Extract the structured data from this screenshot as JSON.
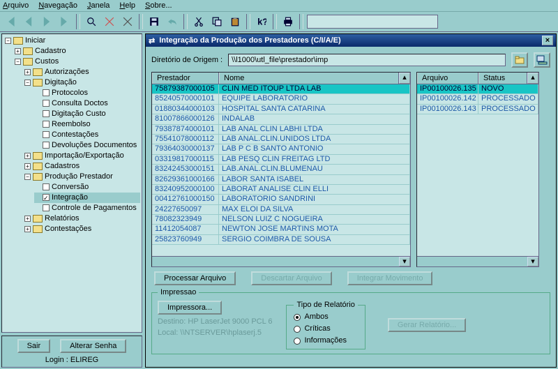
{
  "menu": {
    "arquivo": "Arquivo",
    "navegacao": "Navegação",
    "janela": "Janela",
    "help": "Help",
    "sobre": "Sobre..."
  },
  "tree": {
    "root": "Iniciar",
    "cadastro": "Cadastro",
    "custos": "Custos",
    "autorizacoes": "Autorizações",
    "digitacao": "Digitação",
    "protocolos": "Protocolos",
    "consultaDoctos": "Consulta Doctos",
    "digitacaoCusto": "Digitação Custo",
    "reembolso": "Reembolso",
    "contestacoes1": "Contestações",
    "devolucoes": "Devoluções Documentos",
    "impExp": "Importação/Exportação",
    "cadastros": "Cadastros",
    "prodPrest": "Produção Prestador",
    "conversao": "Conversão",
    "integracao": "Integração",
    "controlePgto": "Controle de Pagamentos",
    "relatorios": "Relatórios",
    "contestacoes2": "Contestações"
  },
  "treeButtons": {
    "sair": "Sair",
    "alterar": "Alterar Senha",
    "login": "Login : ELIREG"
  },
  "win": {
    "title": "Integração da Produção dos Prestadores (C/I/A/E)",
    "dirLabel": "Diretório de Origem :",
    "dirValue": "\\\\l1000\\utl_file\\prestador\\imp"
  },
  "grid1": {
    "h1": "Prestador",
    "h2": "Nome",
    "rows": [
      {
        "p": "75879387000105",
        "n": "CLIN MED ITOUP LTDA LAB",
        "sel": true
      },
      {
        "p": "85240570000101",
        "n": "EQUIPE LABORATORIO"
      },
      {
        "p": "01880344000103",
        "n": "HOSPITAL SANTA CATARINA"
      },
      {
        "p": "81007866000126",
        "n": "INDALAB"
      },
      {
        "p": "79387874000101",
        "n": "LAB ANAL CLIN LABHI LTDA"
      },
      {
        "p": "75541078000112",
        "n": "LAB ANAL.CLIN.UNIDOS LTDA"
      },
      {
        "p": "79364030000137",
        "n": "LAB P C B SANTO ANTONIO"
      },
      {
        "p": "03319817000115",
        "n": "LAB PESQ CLIN FREITAG LTD"
      },
      {
        "p": "83242453000151",
        "n": "LAB.ANAL.CLIN.BLUMENAU"
      },
      {
        "p": "82629361000166",
        "n": "LABOR SANTA ISABEL"
      },
      {
        "p": "83240952000100",
        "n": "LABORAT ANALISE CLIN ELLI"
      },
      {
        "p": "00412761000150",
        "n": "LABORATORIO SANDRINI"
      },
      {
        "p": "24227650097",
        "n": "MAX ELOI DA SILVA"
      },
      {
        "p": "78082323949",
        "n": "NELSON LUIZ C NOGUEIRA"
      },
      {
        "p": "11412054087",
        "n": "NEWTON JOSE MARTINS MOTA"
      },
      {
        "p": "25823760949",
        "n": "SERGIO COIMBRA DE SOUSA"
      }
    ]
  },
  "grid2": {
    "h1": "Arquivo",
    "h2": "Status",
    "rows": [
      {
        "a": "IP00100026.135",
        "s": "NOVO",
        "sel": true
      },
      {
        "a": "IP00100026.142",
        "s": "PROCESSADO"
      },
      {
        "a": "IP00100026.143",
        "s": "PROCESSADO"
      }
    ]
  },
  "btns": {
    "proc": "Processar Arquivo",
    "desc": "Descartar Arquivo",
    "integ": "Integrar Movimento"
  },
  "imp": {
    "legend": "Impressao",
    "impressora": "Impressora...",
    "destino": "Destino: HP LaserJet 9000 PCL 6",
    "local": "Local: \\\\NTSERVER\\hplaserj.5",
    "tipo": "Tipo de Relatório",
    "ambos": "Ambos",
    "criticas": "Críticas",
    "info": "Informações",
    "gerar": "Gerar Relatório..."
  }
}
